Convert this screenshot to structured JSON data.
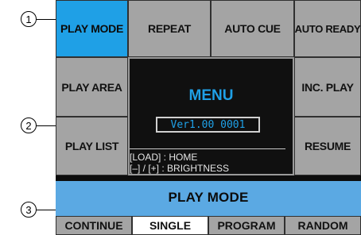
{
  "callouts": [
    "1",
    "2",
    "3"
  ],
  "grid": {
    "row1": [
      "PLAY MODE",
      "REPEAT",
      "AUTO CUE",
      "AUTO READY"
    ],
    "left": [
      "PLAY AREA",
      "PLAY LIST"
    ],
    "right": [
      "INC. PLAY",
      "RESUME"
    ]
  },
  "menu": {
    "title": "MENU",
    "version": "Ver1.00 0001",
    "help_line1": "[LOAD] : HOME",
    "help_line2": "[–] / [+] : BRIGHTNESS"
  },
  "play_mode": {
    "title": "PLAY MODE",
    "options": [
      "CONTINUE",
      "SINGLE",
      "PROGRAM",
      "RANDOM"
    ],
    "selected": "SINGLE"
  },
  "colors": {
    "accent": "#1fa0e6",
    "band": "#5ba9e3",
    "button": "#a4a4a4",
    "screen": "#0d0d0d"
  }
}
